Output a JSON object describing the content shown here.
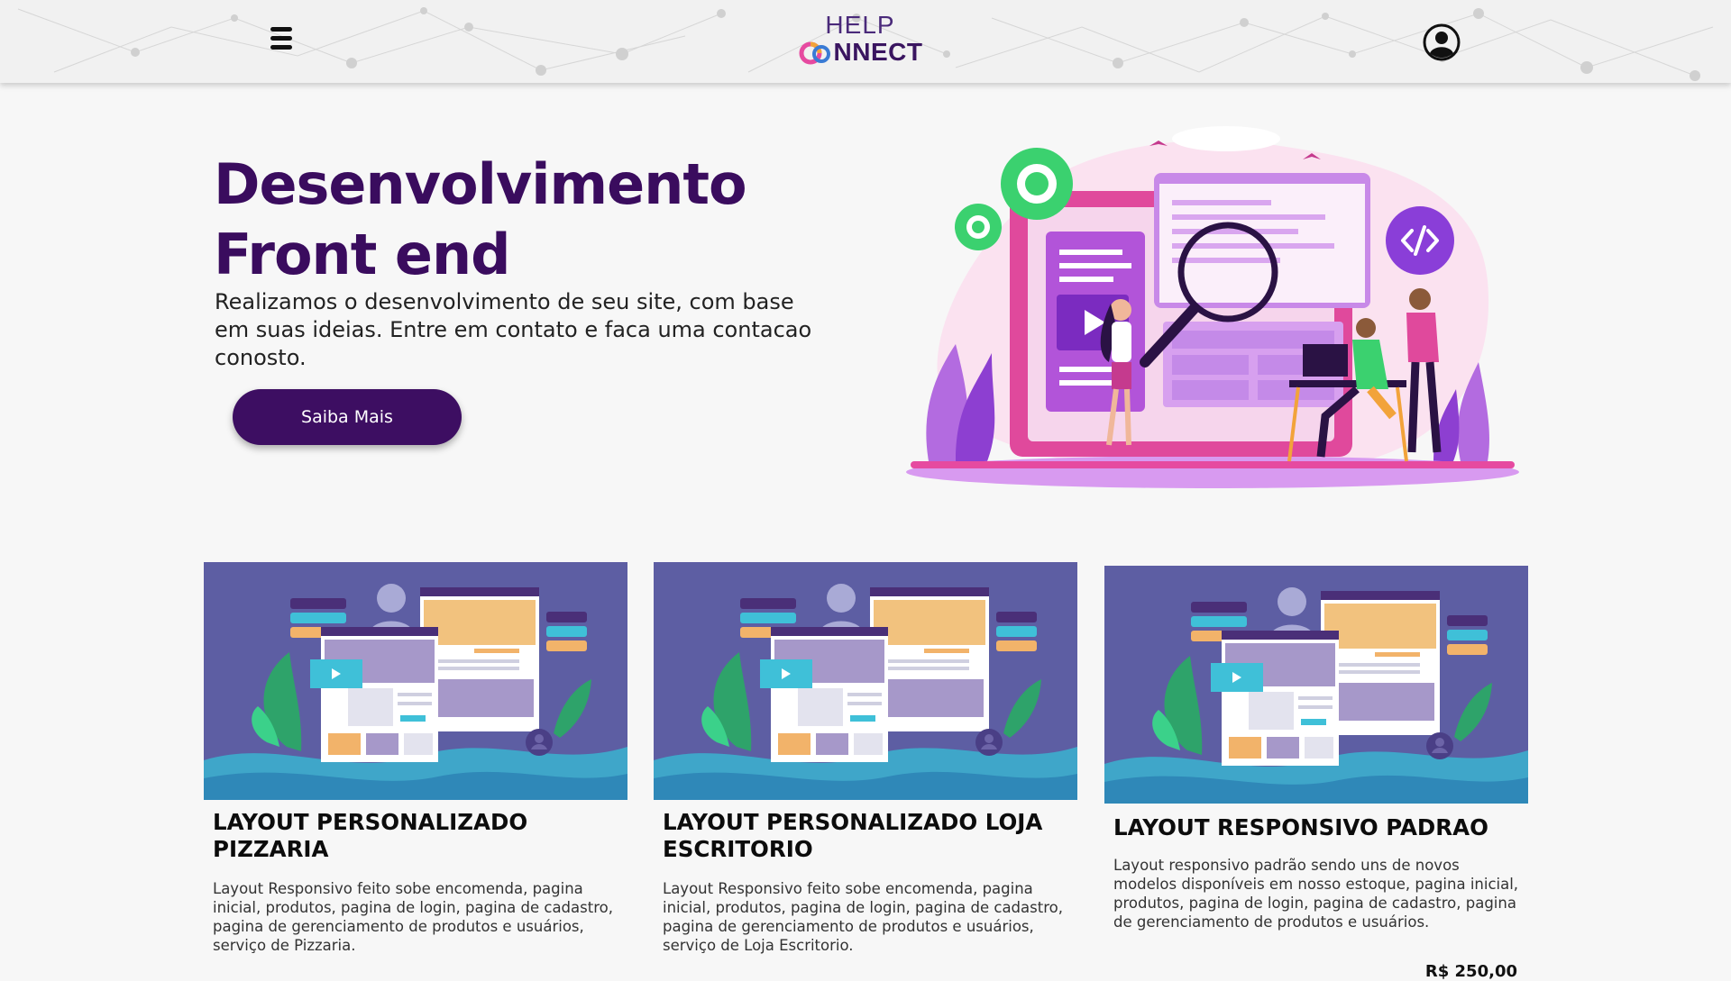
{
  "header": {
    "logo_top": "HELP",
    "logo_bottom": "NNECT"
  },
  "hero": {
    "title_line1": "Desenvolvimento",
    "title_line2": "Front end",
    "description": "Realizamos o desenvolvimento de seu site, com base em suas ideias. Entre em contato e faca uma contacao conosto.",
    "button_label": "Saiba Mais"
  },
  "cards": [
    {
      "title": "LAYOUT PERSONALIZADO PIZZARIA",
      "description": "Layout Responsivo feito sobe encomenda, pagina inicial, produtos, pagina de login, pagina de cadastro, pagina de gerenciamento de produtos e usuários, serviço de Pizzaria."
    },
    {
      "title": "LAYOUT PERSONALIZADO LOJA ESCRITORIO",
      "description": "Layout Responsivo feito sobe encomenda, pagina inicial, produtos, pagina de login, pagina de cadastro, pagina de gerenciamento de produtos e usuários, serviço de Loja Escritorio."
    },
    {
      "title": "LAYOUT RESPONSIVO PADRAO",
      "description": "Layout responsivo padrão sendo uns de novos modelos disponíveis em nosso estoque, pagina inicial, produtos, pagina de login, pagina de cadastro, pagina de gerenciamento de produtos e usuários.",
      "price": "R$ 250,00"
    }
  ],
  "colors": {
    "brand": "#3d0e62",
    "title": "#3a0c5e",
    "card_bg": "#5a5a9e",
    "accent_green": "#3bd16f"
  },
  "icons": {
    "menu": "hamburger-menu-icon",
    "user": "user-circle-icon"
  }
}
